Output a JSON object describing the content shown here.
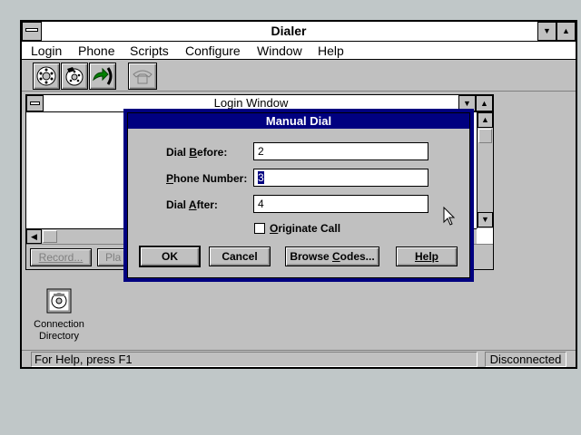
{
  "app": {
    "title": "Dialer",
    "menu": [
      "Login",
      "Phone",
      "Scripts",
      "Configure",
      "Window",
      "Help"
    ],
    "toolbar": {
      "icons": [
        "phone-dial-icon",
        "phone-directory-icon",
        "phone-hangup-arrow-icon",
        "phone-disabled-icon"
      ]
    },
    "status": {
      "help": "For Help, press F1",
      "connection": "Disconnected"
    }
  },
  "login_window": {
    "title": "Login Window",
    "buttons": [
      "Record...",
      "Pla"
    ]
  },
  "desktop_icon": {
    "label_line1": "Connection",
    "label_line2": "Directory"
  },
  "dialog": {
    "title": "Manual Dial",
    "fields": {
      "dial_before": {
        "label": "Dial Before:",
        "value": "2"
      },
      "phone_number": {
        "label": "Phone Number:",
        "value": "3"
      },
      "dial_after": {
        "label": "Dial After:",
        "value": "4"
      }
    },
    "checkbox": {
      "label": "Originate Call",
      "checked": false
    },
    "buttons": {
      "ok": "OK",
      "cancel": "Cancel",
      "browse": "Browse Codes...",
      "help": "Help"
    }
  },
  "colors": {
    "title_active": "#000080",
    "desktop": "#c0c7c8",
    "face": "#c0c0c0"
  }
}
